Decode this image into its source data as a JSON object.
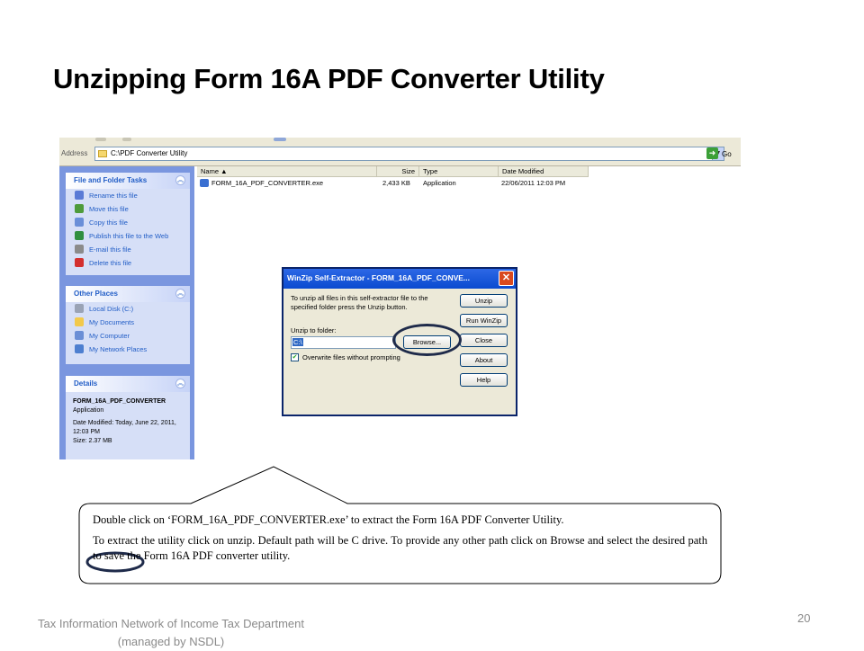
{
  "slide": {
    "title": "Unzipping Form 16A PDF Converter Utility",
    "footer_line1": "Tax Information Network of Income Tax Department",
    "footer_line2": "(managed by NSDL)",
    "page_number": "20"
  },
  "explorer": {
    "address_label": "Address",
    "address_value": "C:\\PDF Converter Utility",
    "go_label": "Go",
    "columns": {
      "name": "Name",
      "size": "Size",
      "type": "Type",
      "date": "Date Modified"
    },
    "file": {
      "name": "FORM_16A_PDF_CONVERTER.exe",
      "size": "2,433 KB",
      "type": "Application",
      "date": "22/06/2011 12:03 PM"
    },
    "file_tasks": {
      "title": "File and Folder Tasks",
      "items": [
        {
          "label": "Rename this file",
          "icon": "rename-icon",
          "color": "#5a7bd6"
        },
        {
          "label": "Move this file",
          "icon": "move-icon",
          "color": "#4e9b3a"
        },
        {
          "label": "Copy this file",
          "icon": "copy-icon",
          "color": "#6a8fd8"
        },
        {
          "label": "Publish this file to the Web",
          "icon": "globe-icon",
          "color": "#2f8f3f"
        },
        {
          "label": "E-mail this file",
          "icon": "email-icon",
          "color": "#8b8b8b"
        },
        {
          "label": "Delete this file",
          "icon": "delete-icon",
          "color": "#d32f2f"
        }
      ]
    },
    "other_places": {
      "title": "Other Places",
      "items": [
        {
          "label": "Local Disk (C:)",
          "icon": "disk-icon",
          "color": "#9aa3b5"
        },
        {
          "label": "My Documents",
          "icon": "folder-icon",
          "color": "#f2c94c"
        },
        {
          "label": "My Computer",
          "icon": "computer-icon",
          "color": "#6b8fd6"
        },
        {
          "label": "My Network Places",
          "icon": "network-icon",
          "color": "#4d7fd0"
        }
      ]
    },
    "details": {
      "title": "Details",
      "file_name": "FORM_16A_PDF_CONVERTER",
      "file_type": "Application",
      "date_modified": "Date Modified: Today, June 22, 2011, 12:03 PM",
      "size": "Size: 2.37 MB"
    }
  },
  "dialog": {
    "title": "WinZip Self-Extractor - FORM_16A_PDF_CONVE...",
    "instructions": "To unzip all files in this self-extractor file to the specified folder press the Unzip button.",
    "unzip_to_label": "Unzip to folder:",
    "folder_value": "C:\\",
    "browse_label": "Browse...",
    "overwrite_label": "Overwrite files without prompting",
    "buttons": [
      "Unzip",
      "Run WinZip",
      "Close",
      "About",
      "Help"
    ]
  },
  "callout": {
    "line1": "Double click on ‘FORM_16A_PDF_CONVERTER.exe’ to extract the Form 16A PDF Converter Utility.",
    "line2": "To extract the utility click on unzip. Default path will be C drive. To provide any other path click on Browse and select the desired path to save the Form 16A PDF converter utility."
  }
}
